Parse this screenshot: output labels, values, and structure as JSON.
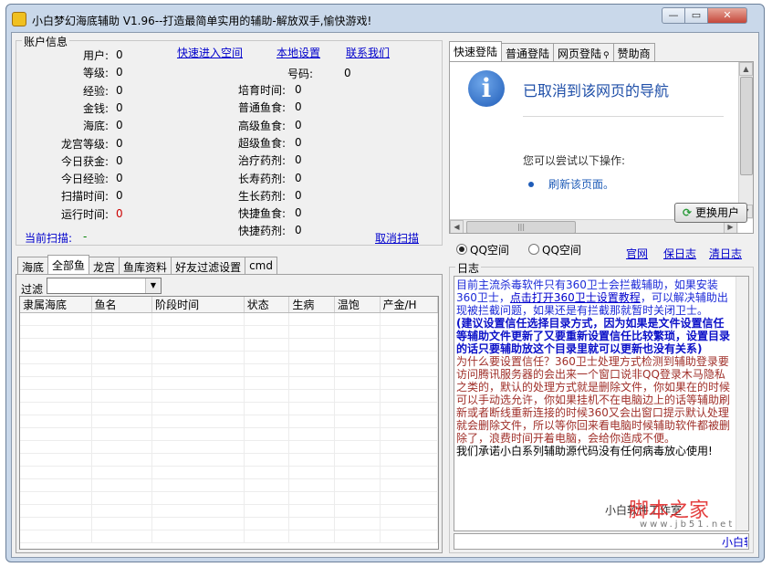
{
  "window": {
    "title": "小白梦幻海底辅助 V1.96--打造最简单实用的辅助-解放双手,愉快游戏!",
    "min_glyph": "—",
    "max_glyph": "▭",
    "close_glyph": "✕"
  },
  "account": {
    "legend": "账户信息",
    "links": {
      "quick_enter": "快速进入空间",
      "local_settings": "本地设置",
      "contact_us": "联系我们"
    },
    "left": [
      {
        "label": "用户:",
        "value": "0"
      },
      {
        "label": "等级:",
        "value": "0"
      },
      {
        "label": "经验:",
        "value": "0"
      },
      {
        "label": "金钱:",
        "value": "0"
      },
      {
        "label": "海底:",
        "value": "0"
      },
      {
        "label": "龙宫等级:",
        "value": "0"
      },
      {
        "label": "今日获金:",
        "value": "0"
      },
      {
        "label": "今日经验:",
        "value": "0"
      },
      {
        "label": "扫描时间:",
        "value": "0"
      },
      {
        "label": "运行时间:",
        "value": "0"
      }
    ],
    "account_no": {
      "label": "号码:",
      "value": "0"
    },
    "right": [
      {
        "label": "培育时间:",
        "value": "0"
      },
      {
        "label": "普通鱼食:",
        "value": "0"
      },
      {
        "label": "高级鱼食:",
        "value": "0"
      },
      {
        "label": "超级鱼食:",
        "value": "0"
      },
      {
        "label": "治疗药剂:",
        "value": "0"
      },
      {
        "label": "长寿药剂:",
        "value": "0"
      },
      {
        "label": "生长药剂:",
        "value": "0"
      },
      {
        "label": "快捷鱼食:",
        "value": "0"
      },
      {
        "label": "快捷药剂:",
        "value": "0"
      }
    ],
    "scan_label": "当前扫描:",
    "scan_value": "-",
    "cancel_scan": "取消扫描"
  },
  "login_tabs": [
    "快速登陆",
    "普通登陆",
    "网页登陆",
    "赞助商"
  ],
  "login_lock_icon": "lock-icon",
  "browser": {
    "icon": "info-icon",
    "heading": "已取消到该网页的导航",
    "subtext": "您可以尝试以下操作:",
    "refresh_link": "刷新该页面。",
    "grip": "|||"
  },
  "switch_user": {
    "label": "更换用户",
    "icon": "refresh-icon"
  },
  "space": {
    "options": [
      "QQ空间",
      "QQ空间"
    ],
    "links": {
      "official": "官网",
      "save_log": "保日志",
      "clear_log": "清日志"
    }
  },
  "fish_tabs": [
    "海底",
    "全部鱼",
    "龙宫",
    "鱼库资料",
    "好友过滤设置",
    "cmd"
  ],
  "filter": {
    "label": "过滤",
    "value": ""
  },
  "table": {
    "columns": [
      "隶属海底",
      "鱼名",
      "阶段时间",
      "状态",
      "生病",
      "温饱",
      "产金/H"
    ]
  },
  "log": {
    "legend": "日志",
    "paragraphs": [
      {
        "style": "blue",
        "text": "目前主流杀毒软件只有360卫士会拦截辅助，如果安装360卫士，"
      },
      {
        "style": "bold",
        "text": "(建议设置信任选择目录方式，因为如果是文件设置信任等辅助文件更新了又要重新设置信任比较繁琐，设置目录的话只要辅助放这个目录里就可以更新也没有关系)"
      },
      {
        "style": "red",
        "text": "为什么要设置信任？360卫士处理方式检测到辅助登录要访问腾讯服务器的会出来一个窗口说非QQ登录木马隐私之类的，默认的处理方式就是删除文件，你如果在的时候可以手动选允许，你如果挂机不在电脑边上的话等辅助刷新或者断线重新连接的时候360又会出窗口提示默认处理就会删除文件，所以等你回来看电脑时候辅助软件都被删除了，浪费时间开着电脑，会给你造成不便。"
      },
      {
        "style": "black",
        "text": "我们承诺小白系列辅助源代码没有任何病毒放心使用!"
      }
    ],
    "link_text": "点击打开360卫士设置教程",
    "after_link": "，可以解决辅助出现被拦截问题，如果还是有拦截那就暂时关闭卫士。",
    "status": "小白软件工作室",
    "watermark": "脚本之家",
    "watermark_url": "www.jb51.net"
  },
  "colors": {
    "link": "#0000cc",
    "log_blue": "#1c2ad8",
    "log_red": "#a0302a",
    "run_time": "#cc0000",
    "scan_value": "#008000"
  }
}
